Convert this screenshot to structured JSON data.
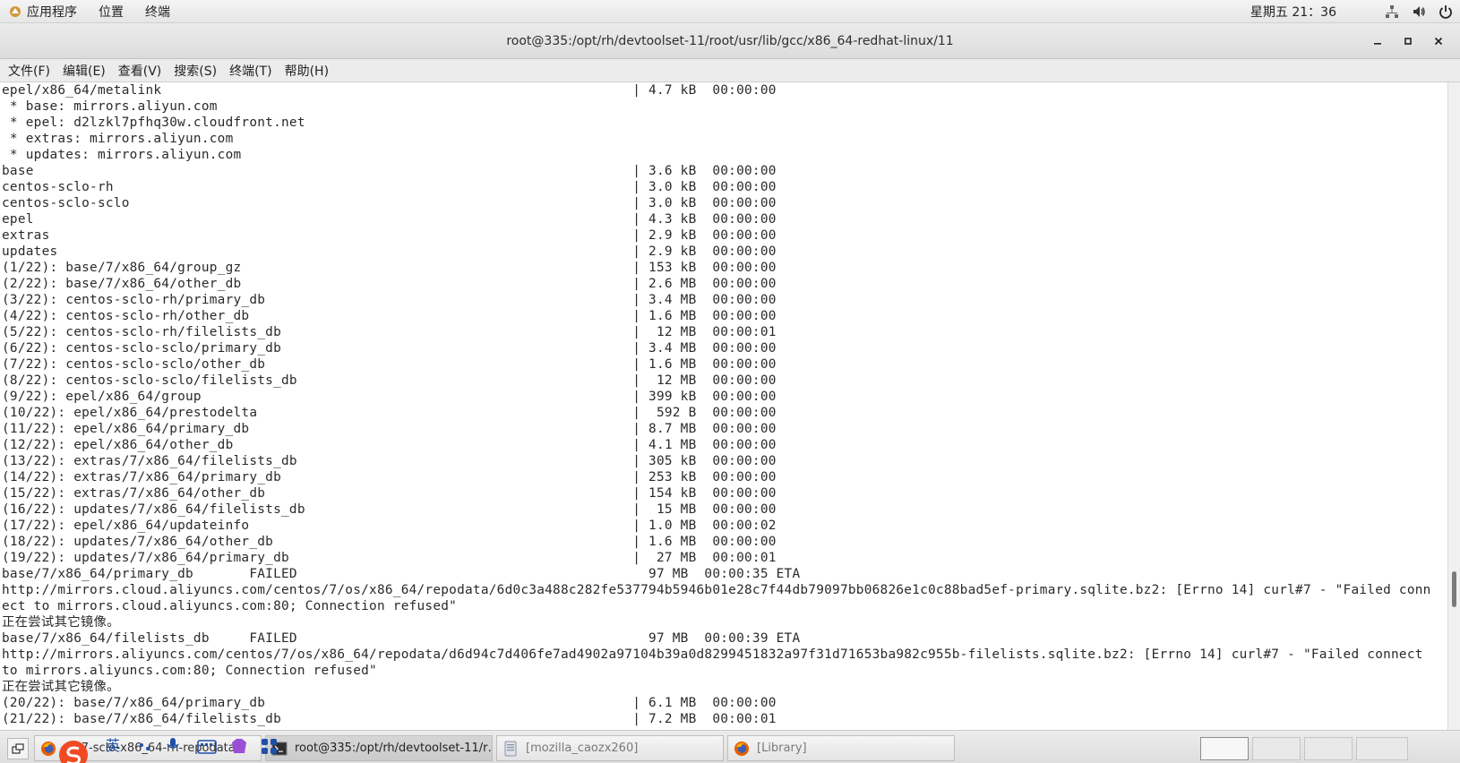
{
  "top_panel": {
    "menu": [
      "应用程序",
      "位置",
      "终端"
    ],
    "clock": "星期五 21：36",
    "icons": [
      "network-icon",
      "volume-icon",
      "power-icon"
    ]
  },
  "window": {
    "title": "root@335:/opt/rh/devtoolset-11/root/usr/lib/gcc/x86_64-redhat-linux/11",
    "controls": [
      "minimize",
      "maximize",
      "close"
    ]
  },
  "menubar": [
    "文件(F)",
    "编辑(E)",
    "查看(V)",
    "搜索(S)",
    "终端(T)",
    "帮助(H)"
  ],
  "terminal": {
    "lines": [
      "epel/x86_64/metalink                                                           | 4.7 kB  00:00:00",
      " * base: mirrors.aliyun.com",
      " * epel: d2lzkl7pfhq30w.cloudfront.net",
      " * extras: mirrors.aliyun.com",
      " * updates: mirrors.aliyun.com",
      "base                                                                           | 3.6 kB  00:00:00",
      "centos-sclo-rh                                                                 | 3.0 kB  00:00:00",
      "centos-sclo-sclo                                                               | 3.0 kB  00:00:00",
      "epel                                                                           | 4.3 kB  00:00:00",
      "extras                                                                         | 2.9 kB  00:00:00",
      "updates                                                                        | 2.9 kB  00:00:00",
      "(1/22): base/7/x86_64/group_gz                                                 | 153 kB  00:00:00",
      "(2/22): base/7/x86_64/other_db                                                 | 2.6 MB  00:00:00",
      "(3/22): centos-sclo-rh/primary_db                                              | 3.4 MB  00:00:00",
      "(4/22): centos-sclo-rh/other_db                                                | 1.6 MB  00:00:00",
      "(5/22): centos-sclo-rh/filelists_db                                            |  12 MB  00:00:01",
      "(6/22): centos-sclo-sclo/primary_db                                            | 3.4 MB  00:00:00",
      "(7/22): centos-sclo-sclo/other_db                                              | 1.6 MB  00:00:00",
      "(8/22): centos-sclo-sclo/filelists_db                                          |  12 MB  00:00:00",
      "(9/22): epel/x86_64/group                                                      | 399 kB  00:00:00",
      "(10/22): epel/x86_64/prestodelta                                               |  592 B  00:00:00",
      "(11/22): epel/x86_64/primary_db                                                | 8.7 MB  00:00:00",
      "(12/22): epel/x86_64/other_db                                                  | 4.1 MB  00:00:00",
      "(13/22): extras/7/x86_64/filelists_db                                          | 305 kB  00:00:00",
      "(14/22): extras/7/x86_64/primary_db                                            | 253 kB  00:00:00",
      "(15/22): extras/7/x86_64/other_db                                              | 154 kB  00:00:00",
      "(16/22): updates/7/x86_64/filelists_db                                         |  15 MB  00:00:00",
      "(17/22): epel/x86_64/updateinfo                                                | 1.0 MB  00:00:02",
      "(18/22): updates/7/x86_64/other_db                                             | 1.6 MB  00:00:00",
      "(19/22): updates/7/x86_64/primary_db                                           |  27 MB  00:00:01",
      "base/7/x86_64/primary_db       FAILED                                            97 MB  00:00:35 ETA",
      "http://mirrors.cloud.aliyuncs.com/centos/7/os/x86_64/repodata/6d0c3a488c282fe537794b5946b01e28c7f44db79097bb06826e1c0c88bad5ef-primary.sqlite.bz2: [Errno 14] curl#7 - \"Failed conn",
      "ect to mirrors.cloud.aliyuncs.com:80; Connection refused\"",
      "正在尝试其它镜像。",
      "base/7/x86_64/filelists_db     FAILED                                            97 MB  00:00:39 ETA",
      "http://mirrors.aliyuncs.com/centos/7/os/x86_64/repodata/d6d94c7d406fe7ad4902a97104b39a0d8299451832a97f31d71653ba982c955b-filelists.sqlite.bz2: [Errno 14] curl#7 - \"Failed connect",
      "to mirrors.aliyuncs.com:80; Connection refused\"",
      "正在尝试其它镜像。",
      "(20/22): base/7/x86_64/primary_db                                              | 6.1 MB  00:00:00",
      "(21/22): base/7/x86_64/filelists_db                                            | 7.2 MB  00:00:01"
    ]
  },
  "taskbar": {
    "tasks": [
      {
        "label": "ac-7-sclo-x86_64-rh-repodata",
        "icon": "firefox-icon",
        "state": "normal"
      },
      {
        "label": "root@335:/opt/rh/devtoolset-11/r…",
        "icon": "terminal-icon",
        "state": "active"
      },
      {
        "label": "[mozilla_caozx260]",
        "icon": "file-manager-icon",
        "state": "dim"
      },
      {
        "label": "[Library]",
        "icon": "firefox-icon",
        "state": "dim"
      }
    ],
    "ime_icons": [
      "sogou-icon",
      "ime-chinese-icon",
      "ime-punct-icon",
      "ime-voice-icon",
      "ime-keyboard-icon",
      "ime-skin-icon",
      "ime-tools-icon"
    ],
    "ime_chinese_glyph": "英"
  },
  "colors": {
    "panel_bg": "#e8e8e8",
    "terminal_fg": "#2a2a2a",
    "terminal_bg": "#ffffff",
    "accent_firefox": "#e66000",
    "sogou_red": "#f04a23"
  }
}
